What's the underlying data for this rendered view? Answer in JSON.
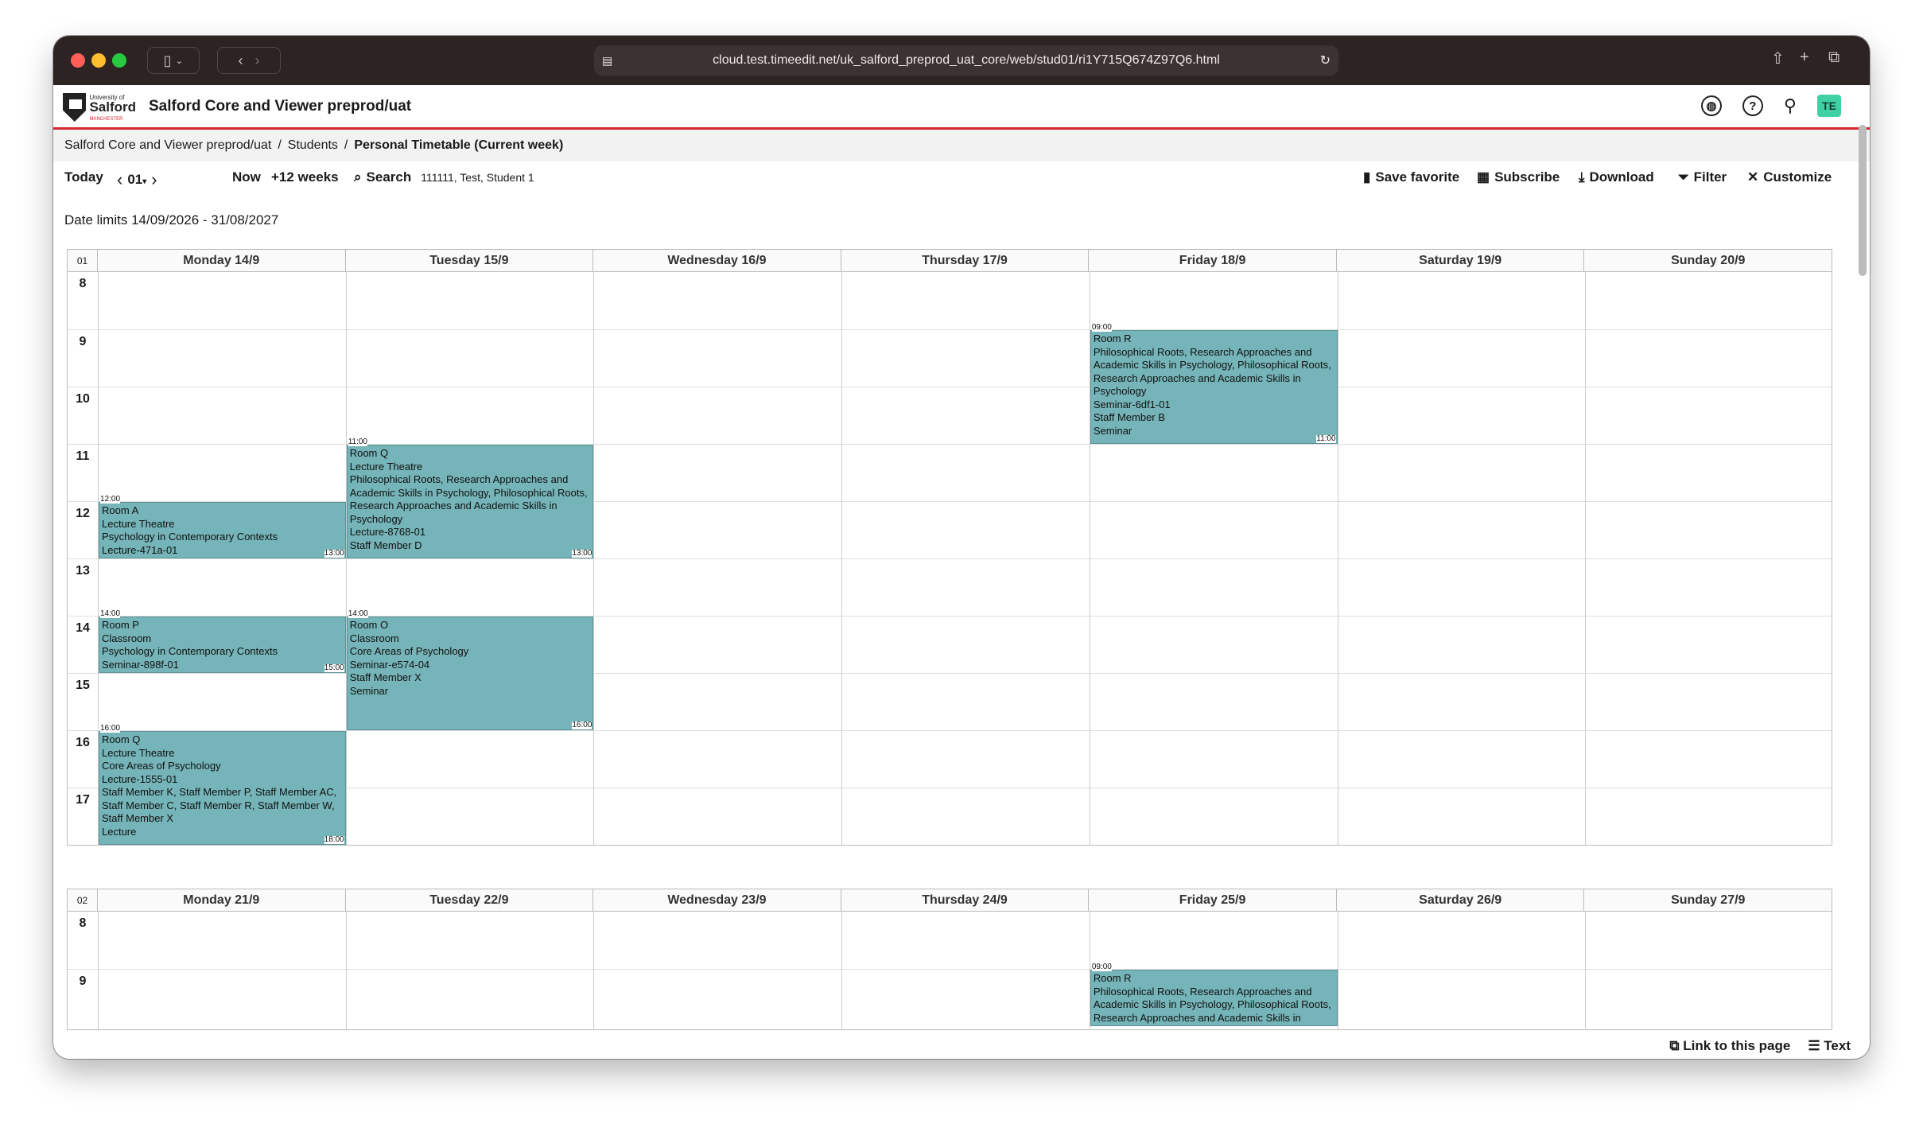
{
  "browser": {
    "url": "cloud.test.timeedit.net/uk_salford_preprod_uat_core/web/stud01/ri1Y715Q674Z97Q6.html",
    "colors": {
      "close": "#ff5f57",
      "minimize": "#febc2e",
      "maximize": "#28c840"
    }
  },
  "header": {
    "logo_small": "University of",
    "logo_name": "Salford",
    "logo_sub": "MANCHESTER",
    "title": "Salford Core and Viewer preprod/uat",
    "te_badge": "TE"
  },
  "breadcrumb": [
    "Salford Core and Viewer preprod/uat",
    "/",
    "Students",
    "/",
    "Personal Timetable (Current week)"
  ],
  "toolbar": {
    "today": "Today",
    "week": "01",
    "now": "Now",
    "plus_weeks": "+12 weeks",
    "search": "Search",
    "search_value": "111111, Test, Student 1",
    "save_favorite": "Save favorite",
    "subscribe": "Subscribe",
    "download": "Download",
    "filter": "Filter",
    "customize": "Customize"
  },
  "date_limits": "Date limits 14/09/2026 - 31/08/2027",
  "weeks": [
    {
      "week": "01",
      "days": [
        "Monday 14/9",
        "Tuesday 15/9",
        "Wednesday 16/9",
        "Thursday 17/9",
        "Friday 18/9",
        "Saturday 19/9",
        "Sunday 20/9"
      ],
      "hours": [
        "8",
        "9",
        "10",
        "11",
        "12",
        "13",
        "14",
        "15",
        "16",
        "17"
      ],
      "events": [
        {
          "day": 0,
          "start": 12,
          "end": 13,
          "start_label": "12:00",
          "end_label": "13:00",
          "lines": [
            "Room A",
            "Lecture Theatre",
            "Psychology in Contemporary Contexts",
            "Lecture-471a-01"
          ]
        },
        {
          "day": 0,
          "start": 14,
          "end": 15,
          "start_label": "14:00",
          "end_label": "15:00",
          "lines": [
            "Room P",
            "Classroom",
            "Psychology in Contemporary Contexts",
            "Seminar-898f-01"
          ]
        },
        {
          "day": 0,
          "start": 16,
          "end": 18,
          "start_label": "16:00",
          "end_label": "18:00",
          "lines": [
            "Room Q",
            "Lecture Theatre",
            "Core Areas of Psychology",
            "Lecture-1555-01",
            "Staff Member  K, Staff Member  P, Staff Member AC, Staff Member C, Staff Member R, Staff Member W, Staff Member X",
            "Lecture"
          ]
        },
        {
          "day": 1,
          "start": 11,
          "end": 13,
          "start_label": "11:00",
          "end_label": "13:00",
          "lines": [
            "Room Q",
            "Lecture Theatre",
            "Philosophical Roots, Research Approaches and Academic Skills in Psychology, Philosophical Roots, Research Approaches and Academic Skills in Psychology",
            "Lecture-8768-01",
            "Staff Member D"
          ]
        },
        {
          "day": 1,
          "start": 14,
          "end": 16,
          "start_label": "14:00",
          "end_label": "16:00",
          "lines": [
            "Room O",
            "Classroom",
            "Core Areas of Psychology",
            "Seminar-e574-04",
            "Staff Member X",
            "Seminar"
          ]
        },
        {
          "day": 4,
          "start": 9,
          "end": 11,
          "start_label": "09:00",
          "end_label": "11:00",
          "lines": [
            "Room R",
            "Philosophical Roots, Research Approaches and Academic Skills in Psychology, Philosophical Roots, Research Approaches and Academic Skills in Psychology",
            "Seminar-6df1-01",
            "Staff Member  B",
            "Seminar"
          ]
        }
      ]
    },
    {
      "week": "02",
      "days": [
        "Monday 21/9",
        "Tuesday 22/9",
        "Wednesday 23/9",
        "Thursday 24/9",
        "Friday 25/9",
        "Saturday 26/9",
        "Sunday 27/9"
      ],
      "hours": [
        "8",
        "9"
      ],
      "events": [
        {
          "day": 4,
          "start": 9,
          "end": 10,
          "start_label": "09:00",
          "end_label": "",
          "lines": [
            "Room R",
            "Philosophical Roots, Research Approaches and Academic Skills in Psychology, Philosophical Roots, Research Approaches and Academic Skills in"
          ]
        }
      ]
    }
  ],
  "footer": {
    "link": "Link to this page",
    "text": "Text"
  }
}
